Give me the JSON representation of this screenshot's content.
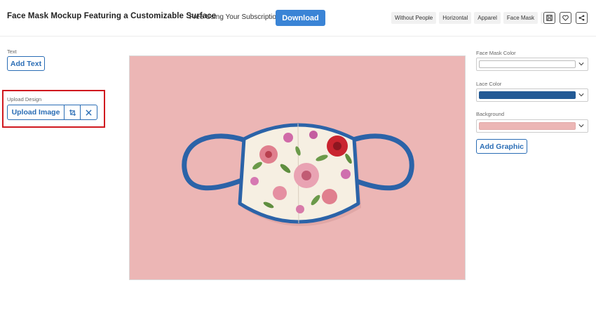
{
  "header": {
    "title": "Face Mask Mockup Featuring a Customizable Surface",
    "promo": "Free Using Your Subscription!",
    "download_label": "Download",
    "tags": [
      "Without People",
      "Horizontal",
      "Apparel",
      "Face Mask"
    ],
    "actions": [
      "save-icon",
      "heart-icon",
      "share-icon"
    ]
  },
  "left": {
    "text_label": "Text",
    "add_text_label": "Add Text",
    "upload_label": "Upload Design",
    "upload_image_label": "Upload Image"
  },
  "right": {
    "mask_color_label": "Face Mask Color",
    "mask_color": "#ffffff",
    "lace_color_label": "Lace Color",
    "lace_color": "#235a95",
    "background_label": "Background",
    "background_color": "#ecb6b5",
    "add_graphic_label": "Add Graphic"
  },
  "colors": {
    "accent": "#2a6db5",
    "download": "#3a84d6",
    "highlight": "#d0191f"
  }
}
